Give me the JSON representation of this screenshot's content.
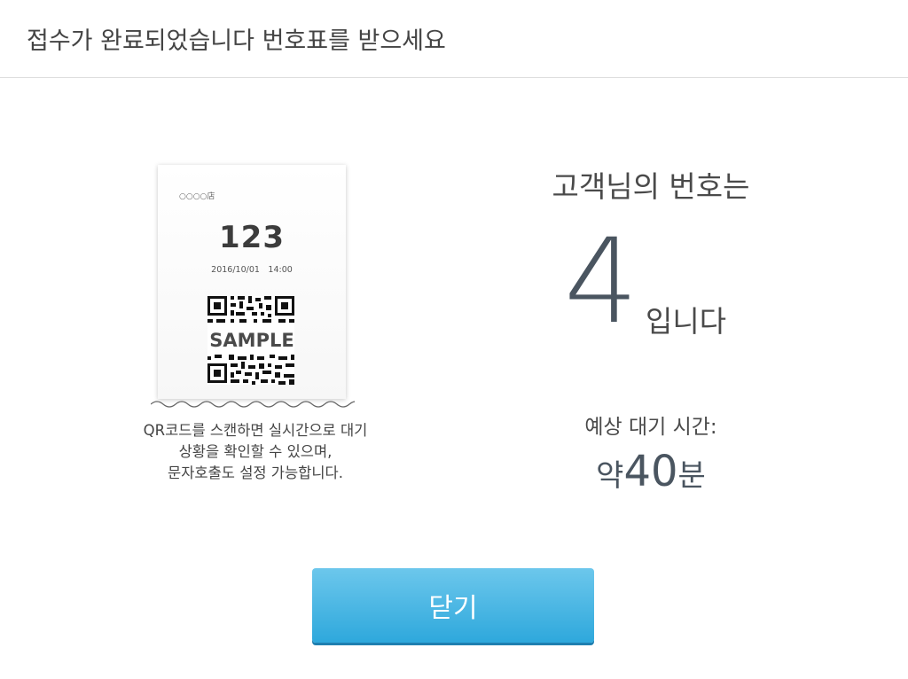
{
  "header": {
    "title": "접수가 완료되었습니다 번호표를 받으세요"
  },
  "ticket": {
    "store": "○○○○店",
    "number": "123",
    "datetime": "2016/10/01　14:00",
    "qr_watermark": "SAMPLE",
    "qr_icon": "qr-code-icon"
  },
  "qr_note": {
    "lines": [
      "QR코드를 스캔하면 실시간으로 대기",
      "상황을 확인할 수 있으며,",
      "문자호출도 설정 가능합니다."
    ]
  },
  "queue": {
    "label": "고객님의 번호는",
    "number": "4",
    "suffix": "입니다"
  },
  "wait": {
    "label": "예상 대기 시간:",
    "prefix": "약",
    "minutes": "40",
    "suffix": "분"
  },
  "actions": {
    "close_label": "닫기"
  },
  "colors": {
    "button_top": "#6cc7ec",
    "button_bottom": "#2ea8dc",
    "number_color": "#4a5560"
  }
}
